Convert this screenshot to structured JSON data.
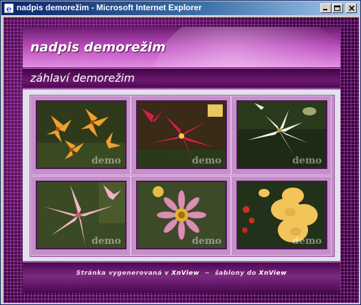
{
  "window": {
    "title": "nadpis demorežim - Microsoft Internet Explorer",
    "icons": {
      "app": "ie-icon",
      "minimize": "minimize-icon",
      "maximize": "maximize-icon",
      "close": "close-icon"
    }
  },
  "header": {
    "title": "nadpis demorežim"
  },
  "subheader": {
    "title": "záhlaví demorežim"
  },
  "gallery": {
    "watermark": "demo",
    "thumbnails": [
      {
        "name": "orange-lilies-photo",
        "watermark": "demo"
      },
      {
        "name": "red-lily-photo",
        "watermark": "demo"
      },
      {
        "name": "white-lily-photo",
        "watermark": "demo"
      },
      {
        "name": "pink-lily-photo",
        "watermark": "demo"
      },
      {
        "name": "gazania-flower-photo",
        "watermark": "demo"
      },
      {
        "name": "yellow-gladiolus-photo",
        "watermark": "demo"
      }
    ]
  },
  "footer": {
    "prefix": "Stránka vygenerovaná v",
    "link1": "XnView",
    "separator": "~",
    "middle": "šablony do",
    "link2": "XnView"
  },
  "colors": {
    "accent": "#b448b6",
    "dark": "#4a0850",
    "titlebar": "#0a246a"
  }
}
